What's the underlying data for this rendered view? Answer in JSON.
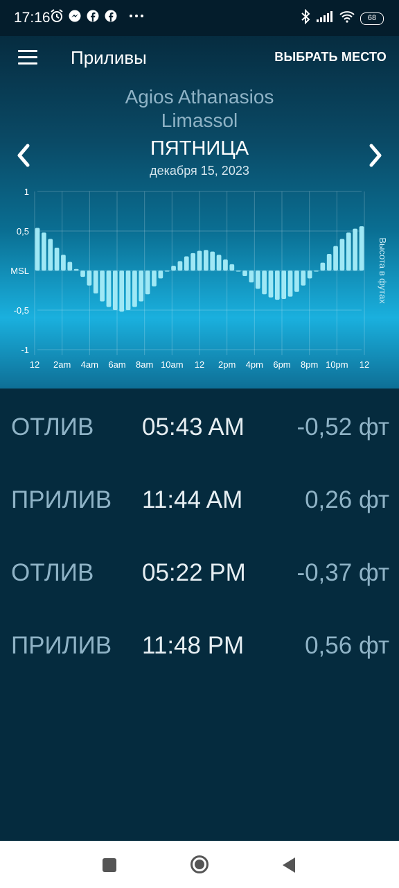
{
  "status_bar": {
    "time": "17:16",
    "battery": "68",
    "left_icons": [
      "alarm-icon",
      "messenger-icon",
      "facebook-icon",
      "facebook-icon",
      "more-icon"
    ],
    "right_icons": [
      "bluetooth-icon",
      "signal-icon",
      "wifi-icon",
      "battery-icon"
    ]
  },
  "toolbar": {
    "title": "Приливы",
    "select_place": "ВЫБРАТЬ МЕСТО"
  },
  "location": {
    "line1": "Agios Athanasios",
    "line2": "Limassol"
  },
  "day": {
    "name": "ПЯТНИЦА",
    "date": "декабря 15, 2023"
  },
  "chart_data": {
    "type": "bar",
    "y_axis_label": "Высота в футах",
    "ylim": [
      -1,
      1
    ],
    "y_ticks": [
      "1",
      "0,5",
      "MSL",
      "-0,5",
      "-1"
    ],
    "x_ticks": [
      "12",
      "2am",
      "4am",
      "6am",
      "8am",
      "10am",
      "12",
      "2pm",
      "4pm",
      "6pm",
      "8pm",
      "10pm",
      "12"
    ],
    "grid": true,
    "bar_color": "#9fe8f5",
    "values": [
      0.54,
      0.48,
      0.4,
      0.29,
      0.2,
      0.11,
      0.02,
      -0.08,
      -0.19,
      -0.29,
      -0.39,
      -0.46,
      -0.5,
      -0.52,
      -0.5,
      -0.46,
      -0.39,
      -0.3,
      -0.2,
      -0.1,
      -0.01,
      0.06,
      0.12,
      0.18,
      0.22,
      0.25,
      0.26,
      0.24,
      0.2,
      0.14,
      0.08,
      0.0,
      -0.07,
      -0.15,
      -0.23,
      -0.3,
      -0.34,
      -0.37,
      -0.36,
      -0.33,
      -0.27,
      -0.19,
      -0.1,
      0.0,
      0.1,
      0.21,
      0.31,
      0.4,
      0.48,
      0.53,
      0.56
    ]
  },
  "tides": [
    {
      "type": "ОТЛИВ",
      "time": "05:43 AM",
      "height": "-0,52 фт"
    },
    {
      "type": "ПРИЛИВ",
      "time": "11:44 AM",
      "height": "0,26 фт"
    },
    {
      "type": "ОТЛИВ",
      "time": "05:22 PM",
      "height": "-0,37 фт"
    },
    {
      "type": "ПРИЛИВ",
      "time": "11:48 PM",
      "height": "0,56 фт"
    }
  ],
  "nav_bar": [
    "recents-icon",
    "home-icon",
    "back-icon"
  ]
}
